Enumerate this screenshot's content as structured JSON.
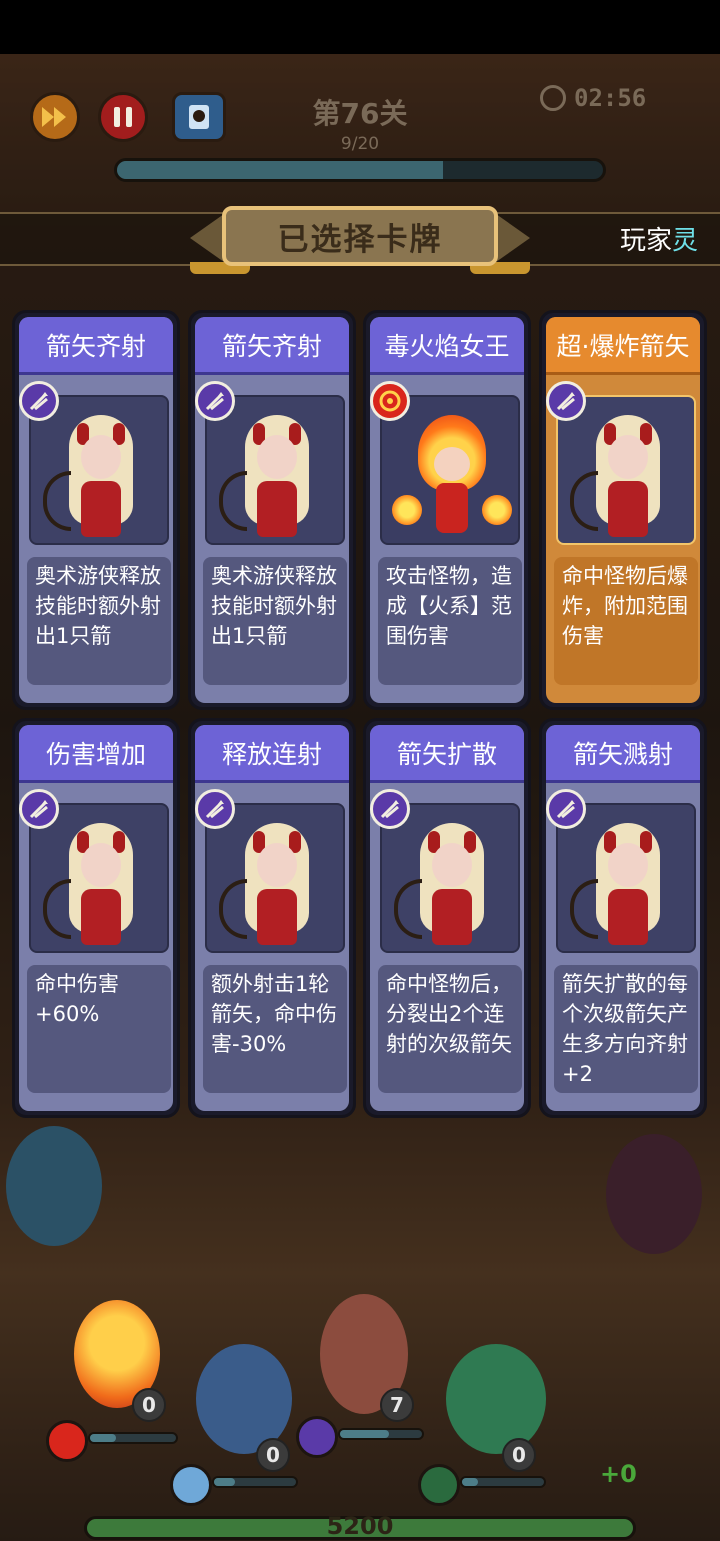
{
  "hud": {
    "level": "第76关",
    "wave": "9/20",
    "timer": "02:56",
    "wave_progress": 0.67
  },
  "banner": {
    "title": "已选择卡牌",
    "player_tab": "玩家",
    "player_tab_cut": "灵"
  },
  "cards": [
    {
      "title": "箭矢齐射",
      "desc": "奥术游侠释放技能时额外射出1只箭",
      "badge": "arrows-icon",
      "style": "purple"
    },
    {
      "title": "箭矢齐射",
      "desc": "奥术游侠释放技能时额外射出1只箭",
      "badge": "arrows-icon",
      "style": "purple"
    },
    {
      "title": "毒火焰女王",
      "desc": "攻击怪物，造成【火系】范围伤害",
      "badge": "fire-target-icon",
      "style": "fire"
    },
    {
      "title": "超·爆炸箭矢",
      "desc": "命中怪物后爆炸，附加范围伤害",
      "badge": "arrows-icon",
      "style": "orange"
    },
    {
      "title": "伤害增加",
      "desc": "命中伤害+60%",
      "badge": "arrows-icon",
      "style": "purple"
    },
    {
      "title": "释放连射",
      "desc": "额外射击1轮箭矢，命中伤害-30%",
      "badge": "arrows-icon",
      "style": "purple"
    },
    {
      "title": "箭矢扩散",
      "desc": "命中怪物后，分裂出2个连射的次级箭矢",
      "badge": "arrows-icon",
      "style": "purple"
    },
    {
      "title": "箭矢溅射",
      "desc": "箭矢扩散的每个次级箭矢产生多方向齐射+2",
      "badge": "arrows-icon",
      "style": "purple"
    }
  ],
  "heroes": {
    "fire_count": "0",
    "ranger_count": "7",
    "ice_count": "0",
    "nature_count": "0",
    "bonus": "+0"
  },
  "gold": "5200"
}
